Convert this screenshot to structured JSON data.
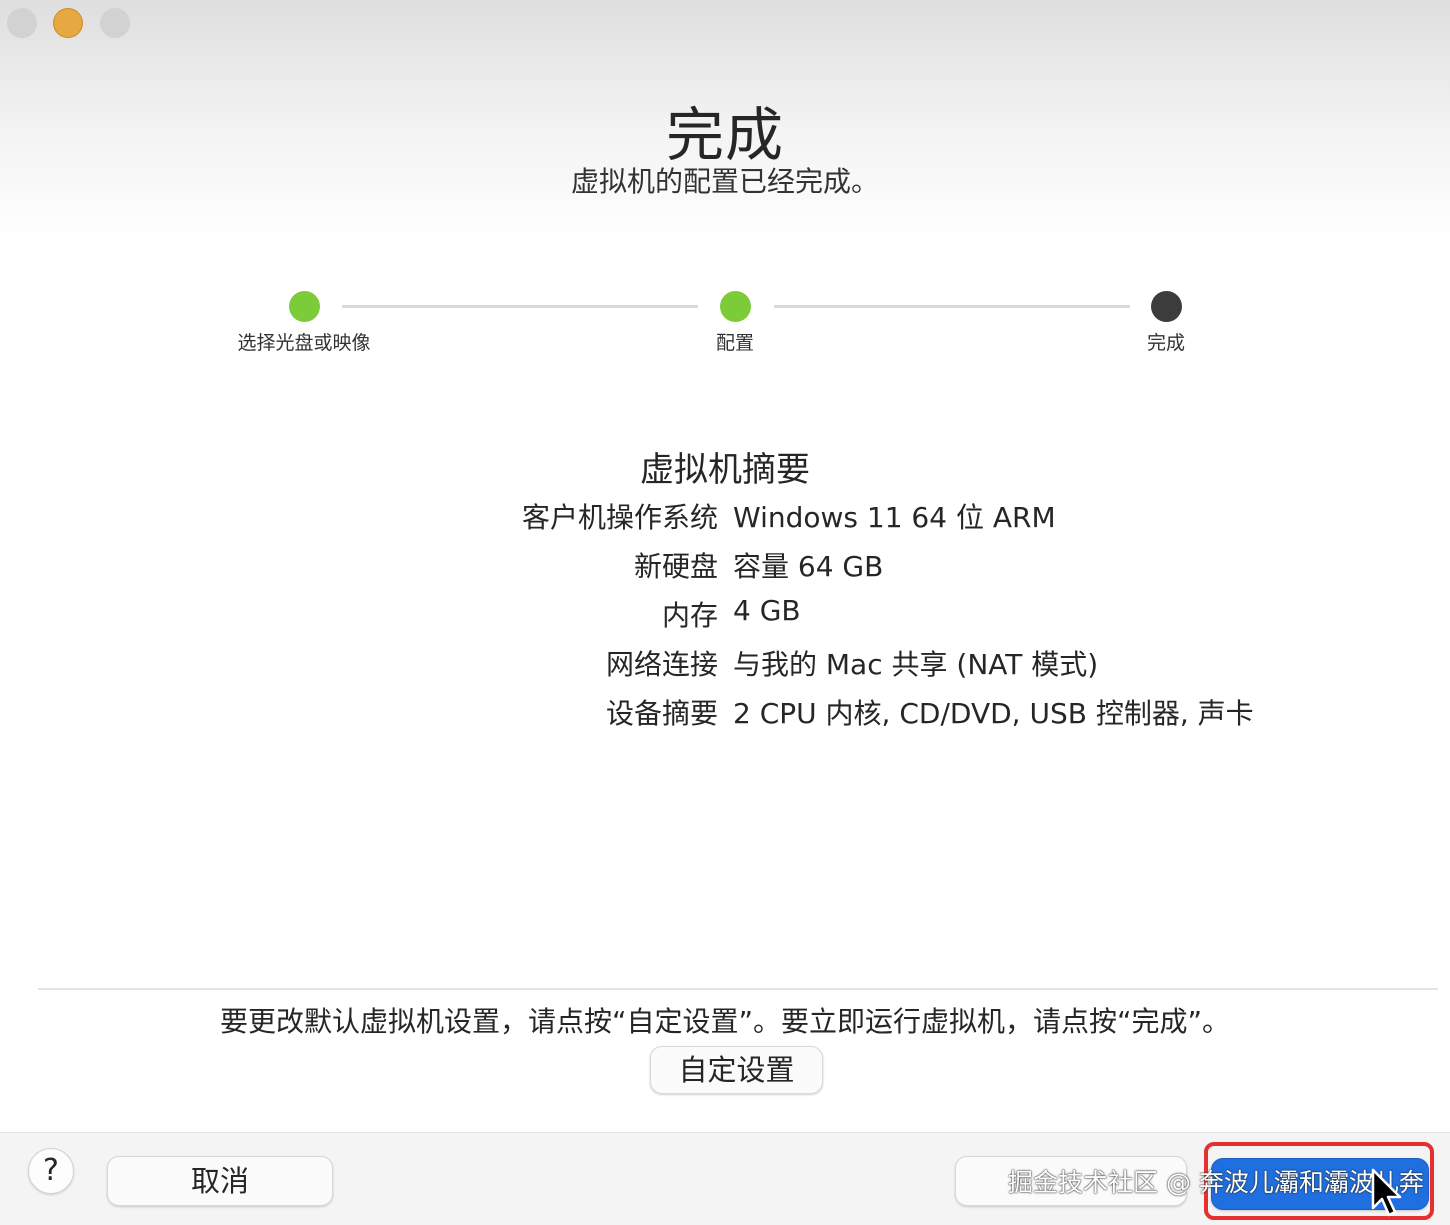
{
  "window": {
    "traffic_lights": [
      "close",
      "minimize",
      "zoom"
    ]
  },
  "header": {
    "title": "完成",
    "subtitle": "虚拟机的配置已经完成。"
  },
  "steps": [
    {
      "label": "选择光盘或映像",
      "state": "done"
    },
    {
      "label": "配置",
      "state": "done"
    },
    {
      "label": "完成",
      "state": "current"
    }
  ],
  "summary": {
    "title": "虚拟机摘要",
    "rows": [
      {
        "key": "客户机操作系统",
        "value": "Windows 11 64 位 ARM"
      },
      {
        "key": "新硬盘",
        "value": "容量 64 GB"
      },
      {
        "key": "内存",
        "value": "4 GB"
      },
      {
        "key": "网络连接",
        "value": "与我的 Mac 共享 (NAT 模式)"
      },
      {
        "key": "设备摘要",
        "value": "2 CPU 内核, CD/DVD, USB 控制器, 声卡"
      }
    ]
  },
  "hint": "要更改默认虚拟机设置，请点按“自定设置”。要立即运行虚拟机，请点按“完成”。",
  "buttons": {
    "custom": "自定设置",
    "help": "?",
    "cancel": "取消",
    "back": "",
    "finish": ""
  },
  "watermark": "掘金技术社区 @ 奔波儿灞和灞波儿奔",
  "colors": {
    "step_done": "#7ccc3a",
    "step_current": "#3c3c3c",
    "primary": "#1f6fe0",
    "highlight": "#e53030"
  }
}
